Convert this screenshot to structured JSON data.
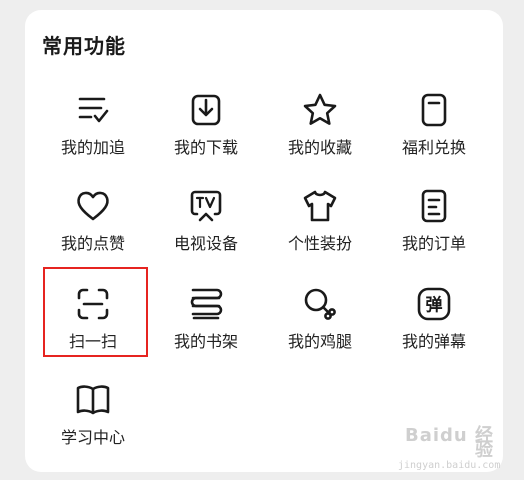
{
  "section": {
    "title": "常用功能"
  },
  "items": [
    {
      "label": "我的加追",
      "icon": "list-check-icon"
    },
    {
      "label": "我的下载",
      "icon": "download-icon"
    },
    {
      "label": "我的收藏",
      "icon": "star-icon"
    },
    {
      "label": "福利兑换",
      "icon": "coupon-icon"
    },
    {
      "label": "我的点赞",
      "icon": "heart-icon"
    },
    {
      "label": "电视设备",
      "icon": "tv-icon"
    },
    {
      "label": "个性装扮",
      "icon": "tshirt-icon"
    },
    {
      "label": "我的订单",
      "icon": "order-icon"
    },
    {
      "label": "扫一扫",
      "icon": "scan-icon"
    },
    {
      "label": "我的书架",
      "icon": "bookshelf-icon"
    },
    {
      "label": "我的鸡腿",
      "icon": "drumstick-icon"
    },
    {
      "label": "我的弹幕",
      "icon": "danmaku-icon",
      "icon_text": "弹"
    },
    {
      "label": "学习中心",
      "icon": "book-icon"
    }
  ],
  "highlighted_item": "扫一扫",
  "colors": {
    "highlight": "#e62420",
    "text": "#222222",
    "icon": "#1a1a1a",
    "card": "#ffffff",
    "background": "#eeeeee"
  },
  "watermark": {
    "logo": "Baidu 经验",
    "sub": "jingyan.baidu.com"
  }
}
